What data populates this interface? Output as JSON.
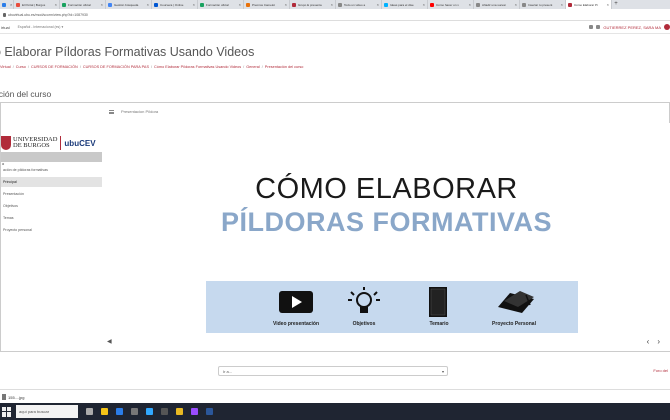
{
  "browser": {
    "tabs": [
      {
        "label": "Ad",
        "fav": "#2b7de9",
        "active": false
      },
      {
        "label": "El Portal | Burgos",
        "fav": "#e84c3d",
        "active": false
      },
      {
        "label": "Formación oficial",
        "fav": "#1aa260",
        "active": false
      },
      {
        "label": "Gestión búsqueda",
        "fav": "#4285f4",
        "active": false
      },
      {
        "label": "Coursera | Online",
        "fav": "#0056d2",
        "active": false
      },
      {
        "label": "Formación oficial",
        "fav": "#1aa260",
        "active": false
      },
      {
        "label": "Premios Camelot",
        "fav": "#e8710a",
        "active": false
      },
      {
        "label": "Grupo E presenta",
        "fav": "#b12b3a",
        "active": false
      },
      {
        "label": "Todo un video a",
        "fav": "#888888",
        "active": false
      },
      {
        "label": "Ideas para el dise",
        "fav": "#00b2ff",
        "active": false
      },
      {
        "label": "Cómo hacer un v",
        "fav": "#ff0000",
        "active": false
      },
      {
        "label": "Añadir una sucesi",
        "fav": "#888888",
        "active": false
      },
      {
        "label": "Insertar tu present",
        "fav": "#888888",
        "active": false
      },
      {
        "label": "Cómo Elaborar Pí",
        "fav": "#b12b3a",
        "active": true
      }
    ],
    "new_tab": "+",
    "url": "ubuvirtual.ubu.es/mod/scorm/view.php?id=1087930"
  },
  "header": {
    "brand": "irtual",
    "language": "Español - Internacional (es) ▾",
    "user_name": "GUTIERREZ PEREZ, SARA MA"
  },
  "page": {
    "title": "o Elaborar Píldoras Formativas Usando Videos",
    "breadcrumb": [
      "Virtual",
      "Curso",
      "CURSOS DE FORMACIÓN",
      "CURSOS DE FORMACIÓN PARA PAS",
      "Cómo Elaborar Píldoras Formativas Usando Videos",
      "General",
      "Presentación del curso"
    ],
    "section_title": "ación del curso"
  },
  "player": {
    "header_label": "Presentacion Píldora",
    "logo": {
      "line1": "UNIVERSIDAD",
      "line2": "DE BURGOS",
      "brand": "ubuCEV"
    },
    "nav_heading": "o",
    "nav_items": [
      {
        "label": "ación de píldoras formativas",
        "selected": false
      },
      {
        "label": "Principal",
        "selected": true
      },
      {
        "label": "Presentación",
        "selected": false
      },
      {
        "label": "Objetivos",
        "selected": false
      },
      {
        "label": "Temas",
        "selected": false
      },
      {
        "label": "Proyecto personal",
        "selected": false
      }
    ],
    "slide": {
      "line1": "CÓMO ELABORAR",
      "line2": "PÍLDORAS FORMATIVAS",
      "icons": [
        {
          "icon": "video-play-icon",
          "caption": "Video presentación"
        },
        {
          "icon": "lightbulb-icon",
          "caption": "Objetivos"
        },
        {
          "icon": "book-icon",
          "caption": "Temario"
        },
        {
          "icon": "graduation-cap-icon",
          "caption": "Proyecto Personal"
        }
      ]
    },
    "prev": "‹",
    "next": "›"
  },
  "footer": {
    "jump_placeholder": "Ir a...",
    "forum_link": "Foro del"
  },
  "downloads": {
    "file": "155....jpg"
  },
  "taskbar": {
    "search_placeholder": "aquí para buscar"
  }
}
